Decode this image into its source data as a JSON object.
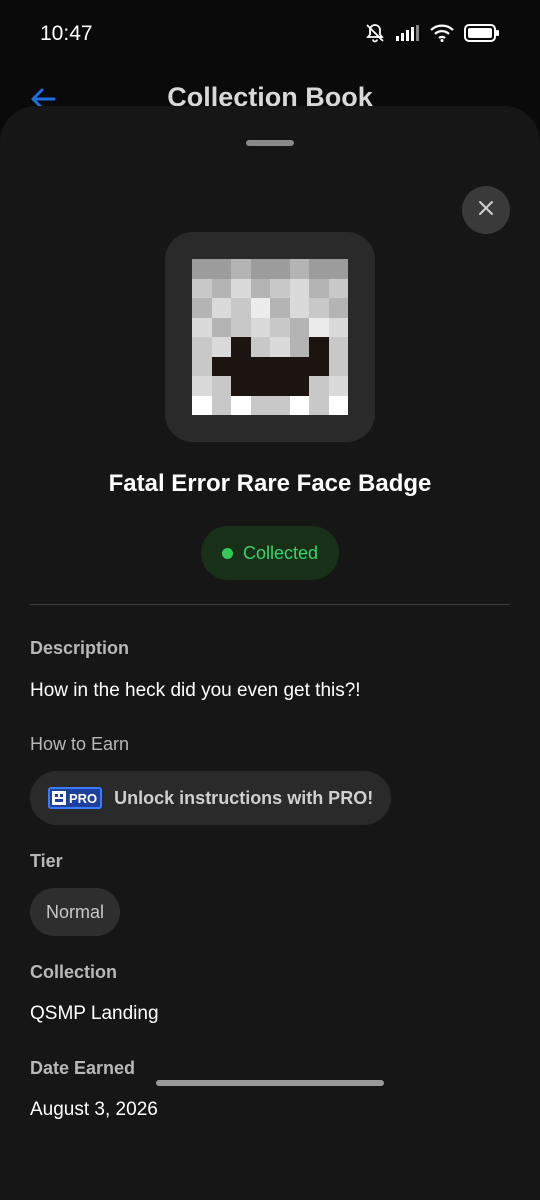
{
  "status_bar": {
    "time": "10:47",
    "icons": [
      "bell-muted-icon",
      "signal-icon",
      "wifi-icon",
      "battery-icon"
    ]
  },
  "background_header": {
    "title": "Collection Book",
    "back_icon": "arrow-left-icon",
    "accent_color": "#1e6fd9"
  },
  "sheet": {
    "close_icon": "close-icon",
    "badge": {
      "image": "pixel-face-badge",
      "name": "Fatal Error Rare Face Badge"
    },
    "status": {
      "label": "Collected",
      "color": "#34c759"
    },
    "description": {
      "label": "Description",
      "text": "How in the heck did you even get this?!"
    },
    "how_to_earn": {
      "label": "How to Earn",
      "pro_badge_text": "PRO",
      "cta": "Unlock instructions with PRO!"
    },
    "tier": {
      "label": "Tier",
      "value": "Normal"
    },
    "collection": {
      "label": "Collection",
      "value": "QSMP Landing"
    },
    "date_earned": {
      "label": "Date Earned",
      "value": "August 3, 2026"
    }
  }
}
